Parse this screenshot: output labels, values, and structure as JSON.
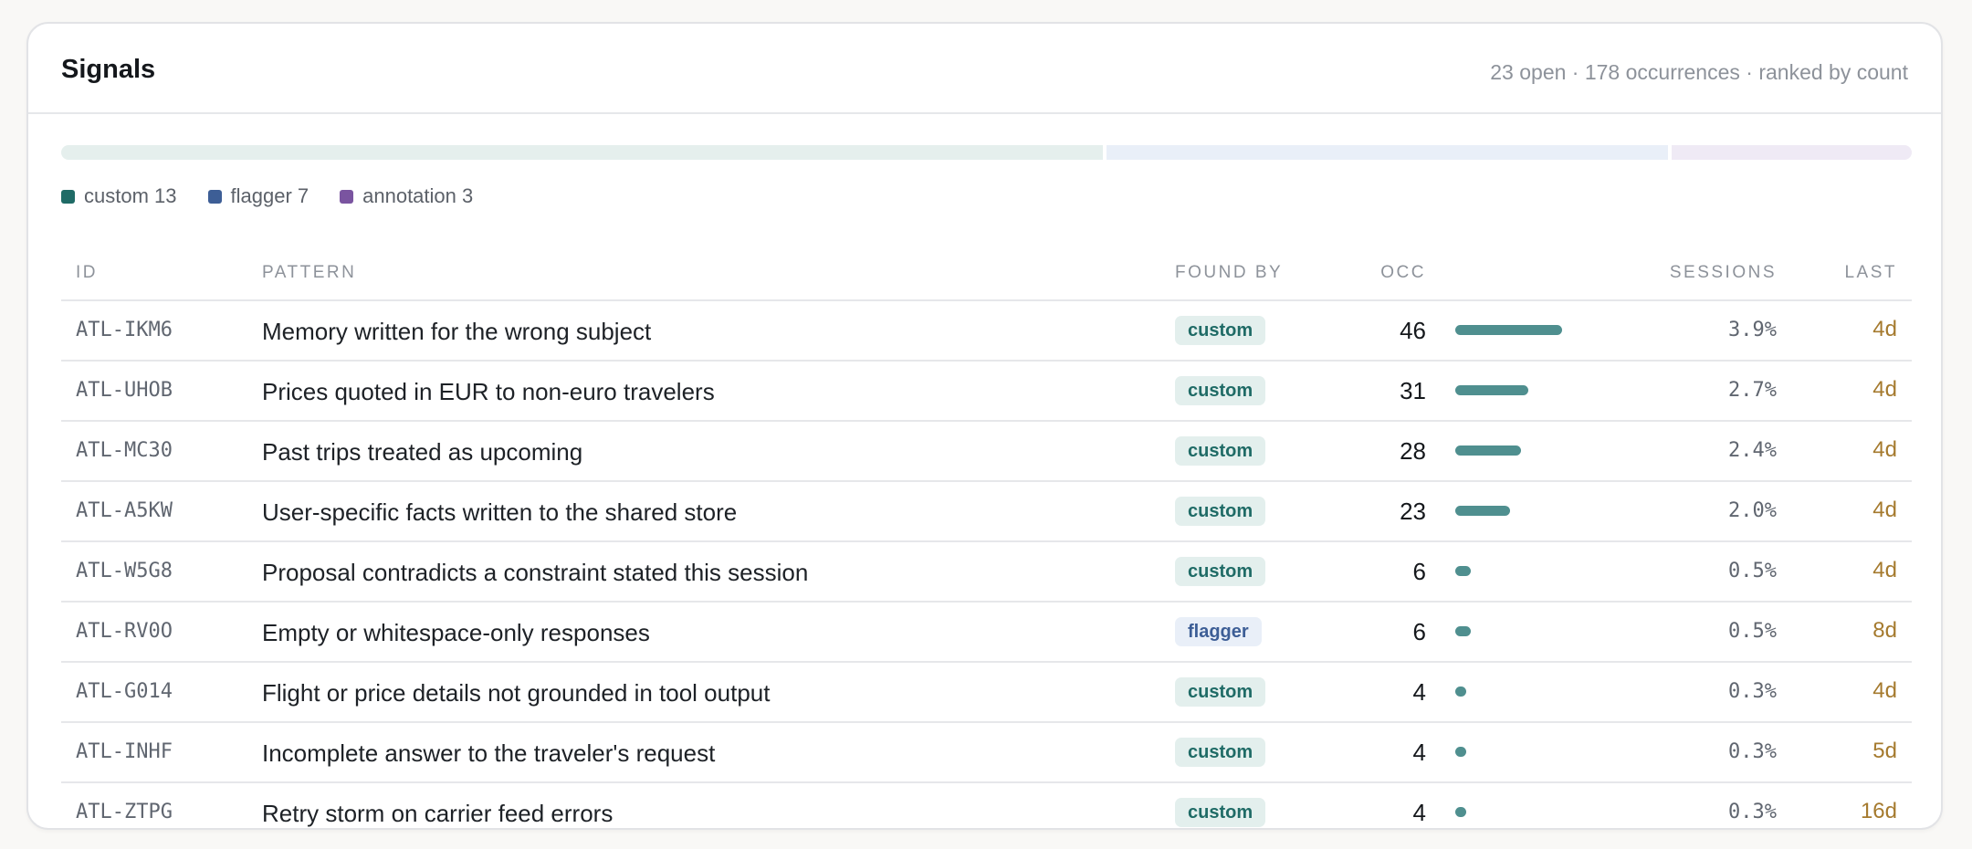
{
  "header": {
    "title": "Signals",
    "summary": "23 open · 178 occurrences · ranked by count"
  },
  "split": [
    {
      "name": "custom",
      "count": 13,
      "label": "custom 13",
      "color": "#1f6b66",
      "bar_color": "#e5efed"
    },
    {
      "name": "flagger",
      "count": 7,
      "label": "flagger 7",
      "color": "#3d5e96",
      "bar_color": "#e9eff8"
    },
    {
      "name": "annotation",
      "count": 3,
      "label": "annotation 3",
      "color": "#7a54a0",
      "bar_color": "#efeaf5"
    }
  ],
  "table": {
    "columns": {
      "id": "ID",
      "pattern": "PATTERN",
      "found_by": "FOUND BY",
      "occ": "OCC",
      "sessions": "SESSIONS",
      "last": "LAST"
    },
    "max_occ": 46,
    "rows": [
      {
        "id": "ATL-IKM6",
        "pattern": "Memory written for the wrong subject",
        "found_by": "custom",
        "occ": "46",
        "sessions": "3.9%",
        "last": "4d"
      },
      {
        "id": "ATL-UHOB",
        "pattern": "Prices quoted in EUR to non-euro travelers",
        "found_by": "custom",
        "occ": "31",
        "sessions": "2.7%",
        "last": "4d"
      },
      {
        "id": "ATL-MC30",
        "pattern": "Past trips treated as upcoming",
        "found_by": "custom",
        "occ": "28",
        "sessions": "2.4%",
        "last": "4d"
      },
      {
        "id": "ATL-A5KW",
        "pattern": "User-specific facts written to the shared store",
        "found_by": "custom",
        "occ": "23",
        "sessions": "2.0%",
        "last": "4d"
      },
      {
        "id": "ATL-W5G8",
        "pattern": "Proposal contradicts a constraint stated this session",
        "found_by": "custom",
        "occ": "6",
        "sessions": "0.5%",
        "last": "4d"
      },
      {
        "id": "ATL-RV0O",
        "pattern": "Empty or whitespace-only responses",
        "found_by": "flagger",
        "occ": "6",
        "sessions": "0.5%",
        "last": "8d"
      },
      {
        "id": "ATL-G014",
        "pattern": "Flight or price details not grounded in tool output",
        "found_by": "custom",
        "occ": "4",
        "sessions": "0.3%",
        "last": "4d"
      },
      {
        "id": "ATL-INHF",
        "pattern": "Incomplete answer to the traveler's request",
        "found_by": "custom",
        "occ": "4",
        "sessions": "0.3%",
        "last": "5d"
      },
      {
        "id": "ATL-ZTPG",
        "pattern": "Retry storm on carrier feed errors",
        "found_by": "custom",
        "occ": "4",
        "sessions": "0.3%",
        "last": "16d"
      }
    ]
  },
  "badge_styles": {
    "custom": {
      "bg": "#e3efed",
      "fg": "#1f6b66"
    },
    "flagger": {
      "bg": "#e9eff8",
      "fg": "#3d5e96"
    }
  }
}
